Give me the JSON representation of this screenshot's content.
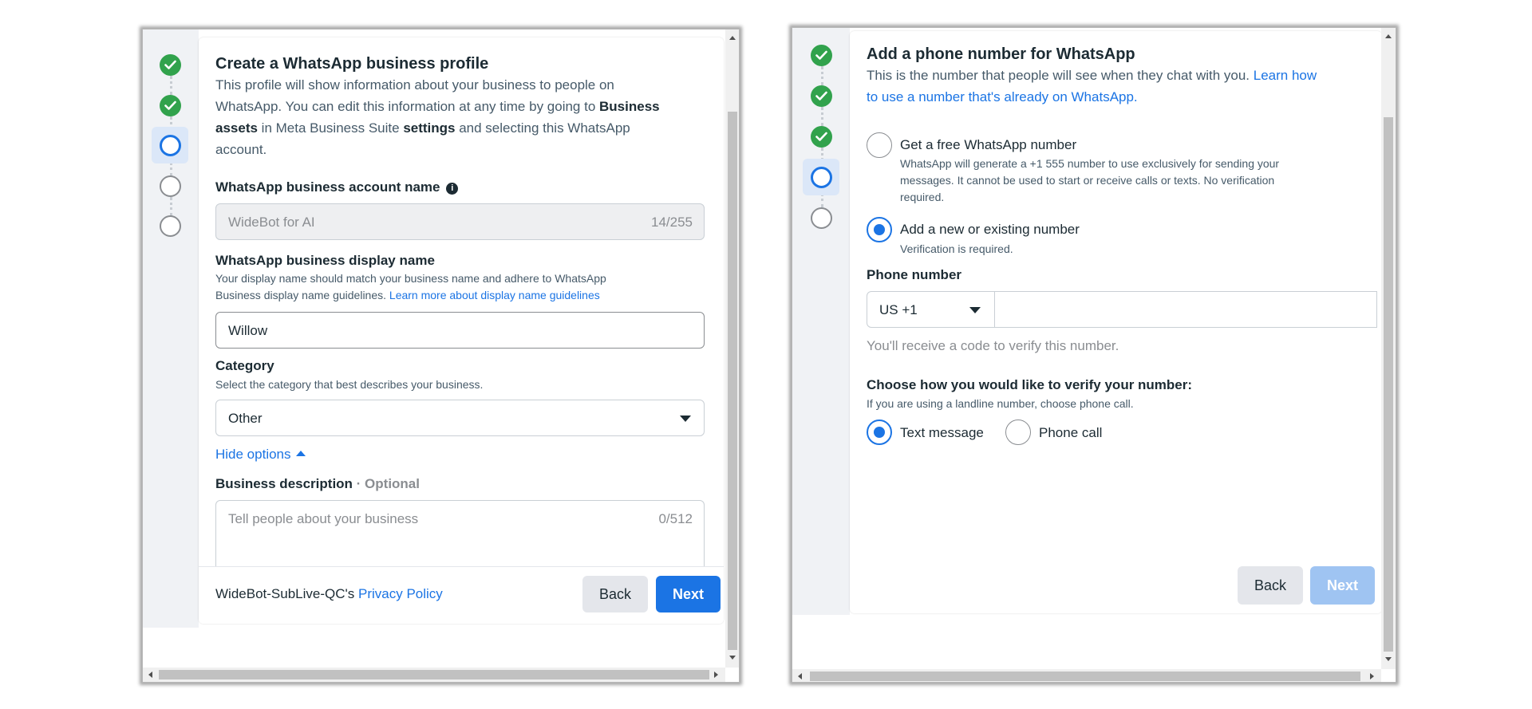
{
  "left_panel": {
    "title": "Create a WhatsApp business profile",
    "intro_line1": "This profile will show information about your business to people on",
    "intro_line2_a": "WhatsApp. You can edit this information at any time by going to ",
    "intro_line2_b": "Business",
    "intro_line3_a": "assets",
    "intro_line3_b": " in Meta Business Suite ",
    "intro_line3_c": "settings",
    "intro_line3_d": " and selecting this WhatsApp",
    "intro_line4": "account.",
    "account_name_label": "WhatsApp business account name",
    "account_name_value": "WideBot for AI",
    "account_name_count": "14/255",
    "display_name_label": "WhatsApp business display name",
    "display_name_help1": "Your display name should match your business name and adhere to WhatsApp",
    "display_name_help2": "Business display name guidelines. ",
    "display_name_link": "Learn more about display name guidelines",
    "display_name_value": "Willow",
    "category_label": "Category",
    "category_help": "Select the category that best describes your business.",
    "category_value": "Other",
    "hide_options": "Hide options",
    "description_label": "Business description",
    "description_optional": " · Optional",
    "description_placeholder": "Tell people about your business",
    "description_count": "0/512",
    "footer_prefix": "WideBot-SubLive-QC's ",
    "footer_link": "Privacy Policy",
    "back_label": "Back",
    "next_label": "Next"
  },
  "right_panel": {
    "title": "Add a phone number for WhatsApp",
    "intro_a": "This is the number that people will see when they chat with you. ",
    "intro_link_1": "Learn how",
    "intro_link_2": "to use a number that's already on WhatsApp.",
    "option1_title": "Get a free WhatsApp number",
    "option1_desc1": "WhatsApp will generate a +1 555 number to use exclusively for sending your",
    "option1_desc2": "messages. It cannot be used to start or receive calls or texts. No verification",
    "option1_desc3": "required.",
    "option2_title": "Add a new or existing number",
    "option2_desc": "Verification is required.",
    "phone_label": "Phone number",
    "country_code": "US +1",
    "phone_help": "You'll receive a code to verify this number.",
    "verify_label": "Choose how you would like to verify your number:",
    "verify_help": "If you are using a landline number, choose phone call.",
    "method_text": "Text message",
    "method_call": "Phone call",
    "back_label": "Back",
    "next_label": "Next"
  },
  "colors": {
    "accent": "#1b74e4",
    "success": "#31a24c",
    "text_primary": "#1c2b33",
    "text_secondary": "#465a69"
  }
}
